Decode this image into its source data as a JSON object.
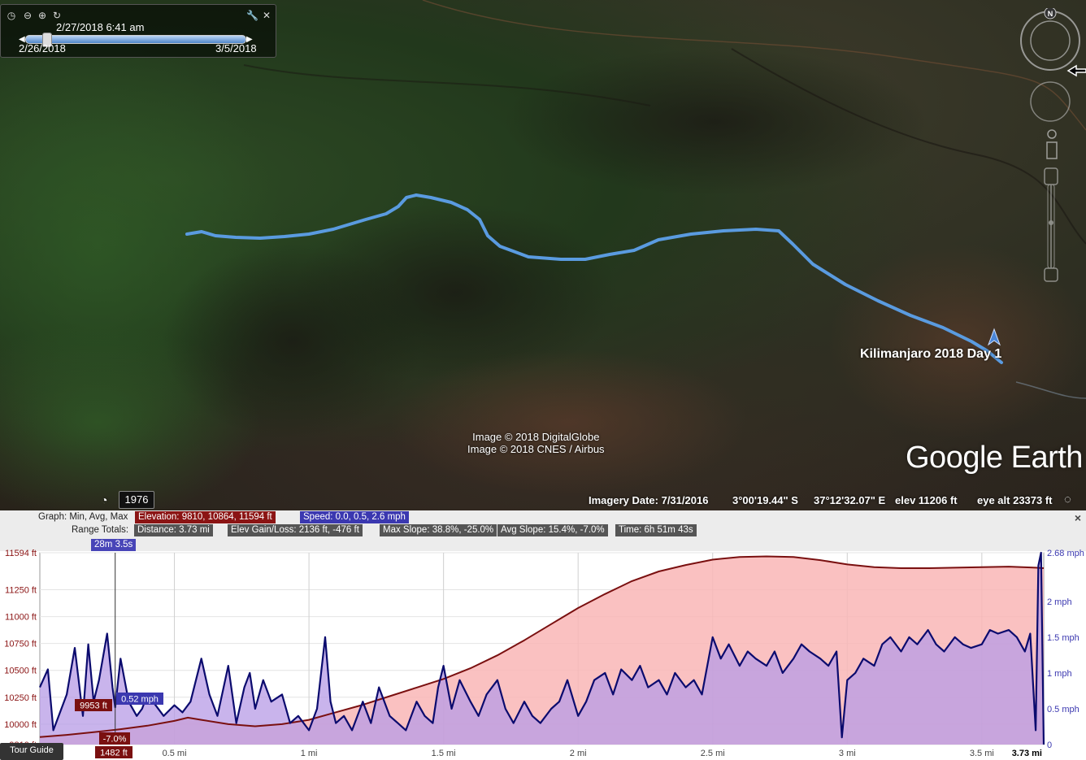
{
  "time_slider": {
    "current": "2/27/2018  6:41 am",
    "start": "2/26/2018",
    "end": "3/5/2018"
  },
  "map": {
    "placemark_label": "Kilimanjaro 2018   Day 1",
    "credit_line_1": "Image © 2018 DigitalGlobe",
    "credit_line_2": "Image © 2018 CNES / Airbus",
    "logo_text": "Google Earth",
    "historical_year": "1976",
    "compass_n": "N",
    "route_color": "#5a9be0"
  },
  "statusbar": {
    "imagery_date": "Imagery Date: 7/31/2016",
    "lat": "3°00'19.44\" S",
    "lon": "37°12'32.07\" E",
    "elev": "elev 11206 ft",
    "eye_alt": "eye alt 23373 ft"
  },
  "graph_header": {
    "graph_label": "Graph: Min, Avg, Max",
    "elevation_chip": "Elevation: 9810, 10864, 11594 ft",
    "speed_chip": "Speed: 0.0, 0.5, 2.6 mph",
    "range_label": "Range Totals:",
    "distance": "Distance: 3.73 mi",
    "elev_gain": "Elev Gain/Loss: 2136 ft, -476 ft",
    "max_slope": "Max Slope: 38.8%, -25.0%",
    "avg_slope": "Avg Slope: 15.4%, -7.0%",
    "time": "Time: 6h 51m 43s",
    "cursor_time": "28m 3.5s",
    "close": "×"
  },
  "cursor": {
    "elevation_label": "9953 ft",
    "speed_label": "0.52 mph",
    "slope_label": "-7.0%",
    "distance_label": "1482 ft",
    "distance_mi": 0.28
  },
  "tour_guide": "Tour Guide",
  "colors": {
    "elevation_line": "#7a1010",
    "elevation_fill": "#f9b6b6",
    "speed_line": "#0b0b6e",
    "speed_fill": "#b79be6"
  },
  "chart_data": {
    "type": "area",
    "xlabel": "",
    "ylabel": "",
    "xlim": [
      0,
      3.73
    ],
    "x_ticks": [
      "0.5 mi",
      "1 mi",
      "1.5 mi",
      "2 mi",
      "2.5 mi",
      "3 mi",
      "3.5 mi",
      "3.73 mi"
    ],
    "x_tick_values": [
      0.5,
      1,
      1.5,
      2,
      2.5,
      3,
      3.5,
      3.73
    ],
    "y_left_ticks": [
      "11594 ft",
      "11250 ft",
      "11000 ft",
      "10750 ft",
      "10500 ft",
      "10250 ft",
      "10000 ft",
      "9810 ft"
    ],
    "y_left_values": [
      11594,
      11250,
      11000,
      10750,
      10500,
      10250,
      10000,
      9810
    ],
    "ylim_left": [
      9810,
      11594
    ],
    "y_right_ticks": [
      "2.68 mph",
      "2 mph",
      "1.5 mph",
      "1 mph",
      "0.5 mph",
      "0"
    ],
    "y_right_values": [
      2.68,
      2,
      1.5,
      1,
      0.5,
      0
    ],
    "ylim_right": [
      0,
      2.68
    ],
    "series": [
      {
        "name": "Elevation",
        "axis": "left",
        "x": [
          0,
          0.1,
          0.2,
          0.3,
          0.4,
          0.5,
          0.55,
          0.6,
          0.7,
          0.8,
          0.9,
          1.0,
          1.1,
          1.2,
          1.3,
          1.4,
          1.5,
          1.6,
          1.7,
          1.8,
          1.9,
          2.0,
          2.1,
          2.2,
          2.3,
          2.4,
          2.5,
          2.6,
          2.7,
          2.8,
          2.9,
          3.0,
          3.1,
          3.2,
          3.3,
          3.4,
          3.5,
          3.6,
          3.7,
          3.73
        ],
        "values": [
          9880,
          9900,
          9925,
          9953,
          9985,
          10030,
          10060,
          10040,
          10000,
          9980,
          10000,
          10040,
          10110,
          10180,
          10260,
          10340,
          10420,
          10520,
          10640,
          10780,
          10930,
          11080,
          11210,
          11330,
          11420,
          11480,
          11530,
          11555,
          11560,
          11555,
          11525,
          11485,
          11460,
          11450,
          11450,
          11455,
          11460,
          11465,
          11455,
          11450
        ]
      },
      {
        "name": "Speed",
        "axis": "right",
        "x": [
          0,
          0.03,
          0.05,
          0.08,
          0.1,
          0.13,
          0.16,
          0.18,
          0.2,
          0.22,
          0.25,
          0.27,
          0.28,
          0.3,
          0.33,
          0.36,
          0.38,
          0.4,
          0.43,
          0.46,
          0.5,
          0.53,
          0.56,
          0.6,
          0.63,
          0.66,
          0.7,
          0.73,
          0.76,
          0.78,
          0.8,
          0.83,
          0.86,
          0.9,
          0.93,
          0.96,
          1.0,
          1.03,
          1.06,
          1.08,
          1.1,
          1.13,
          1.16,
          1.2,
          1.23,
          1.26,
          1.3,
          1.33,
          1.36,
          1.4,
          1.43,
          1.46,
          1.48,
          1.5,
          1.53,
          1.56,
          1.6,
          1.63,
          1.66,
          1.7,
          1.73,
          1.76,
          1.8,
          1.83,
          1.86,
          1.9,
          1.93,
          1.96,
          2.0,
          2.03,
          2.06,
          2.1,
          2.13,
          2.16,
          2.2,
          2.23,
          2.26,
          2.3,
          2.33,
          2.36,
          2.4,
          2.43,
          2.46,
          2.5,
          2.53,
          2.56,
          2.6,
          2.63,
          2.66,
          2.7,
          2.73,
          2.76,
          2.8,
          2.83,
          2.86,
          2.9,
          2.93,
          2.96,
          2.98,
          3.0,
          3.03,
          3.06,
          3.1,
          3.13,
          3.16,
          3.2,
          3.23,
          3.26,
          3.3,
          3.33,
          3.36,
          3.4,
          3.43,
          3.46,
          3.5,
          3.53,
          3.56,
          3.6,
          3.63,
          3.66,
          3.68,
          3.7,
          3.71,
          3.72,
          3.73
        ],
        "values": [
          0.8,
          1.05,
          0.2,
          0.5,
          0.7,
          1.35,
          0.4,
          1.4,
          0.6,
          0.9,
          1.55,
          0.8,
          0.52,
          1.2,
          0.6,
          0.4,
          0.5,
          0.7,
          0.55,
          0.4,
          0.55,
          0.45,
          0.6,
          1.2,
          0.7,
          0.4,
          1.1,
          0.3,
          0.8,
          1.0,
          0.5,
          0.9,
          0.6,
          0.7,
          0.3,
          0.4,
          0.2,
          0.5,
          1.5,
          0.6,
          0.3,
          0.4,
          0.2,
          0.6,
          0.3,
          0.8,
          0.4,
          0.3,
          0.2,
          0.6,
          0.4,
          0.3,
          0.8,
          1.1,
          0.5,
          0.9,
          0.6,
          0.4,
          0.7,
          0.9,
          0.5,
          0.3,
          0.6,
          0.4,
          0.3,
          0.5,
          0.6,
          0.9,
          0.4,
          0.6,
          0.9,
          1.0,
          0.7,
          1.05,
          0.9,
          1.1,
          0.8,
          0.9,
          0.7,
          1.0,
          0.8,
          0.9,
          0.7,
          1.5,
          1.2,
          1.4,
          1.1,
          1.3,
          1.2,
          1.1,
          1.3,
          1.0,
          1.2,
          1.4,
          1.3,
          1.2,
          1.1,
          1.3,
          0.1,
          0.9,
          1.0,
          1.2,
          1.1,
          1.4,
          1.5,
          1.3,
          1.5,
          1.4,
          1.6,
          1.4,
          1.3,
          1.5,
          1.4,
          1.35,
          1.4,
          1.6,
          1.55,
          1.6,
          1.5,
          1.3,
          1.55,
          0.2,
          2.5,
          2.68,
          0.0
        ]
      }
    ]
  }
}
